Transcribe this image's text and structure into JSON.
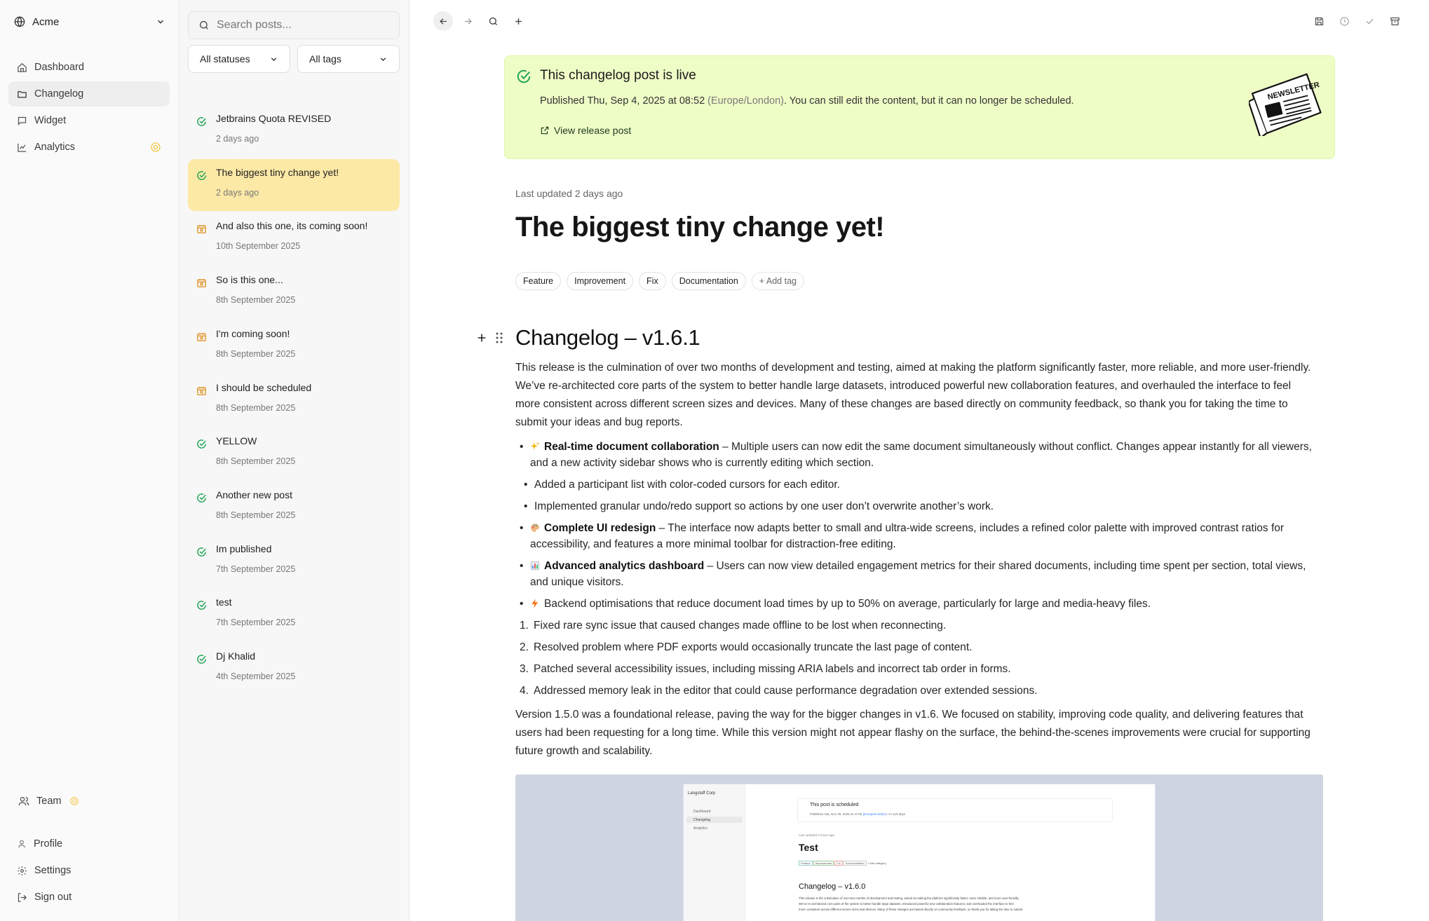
{
  "nav": {
    "workspace": "Acme",
    "items": [
      {
        "label": "Dashboard",
        "icon": "home-icon"
      },
      {
        "label": "Changelog",
        "icon": "folder-icon"
      },
      {
        "label": "Widget",
        "icon": "message-square-icon"
      },
      {
        "label": "Analytics",
        "icon": "chart-line-icon"
      }
    ],
    "bottom": [
      {
        "label": "Team",
        "icon": "users-icon"
      },
      {
        "label": "Profile",
        "icon": "user-icon"
      },
      {
        "label": "Settings",
        "icon": "gear-icon"
      },
      {
        "label": "Sign out",
        "icon": "log-out-icon"
      }
    ]
  },
  "list": {
    "search_placeholder": "Search posts...",
    "status_filter": "All statuses",
    "tag_filter": "All tags",
    "posts": [
      {
        "title": "Jetbrains Quota REVISED",
        "date": "2 days ago",
        "status": "published"
      },
      {
        "title": "The biggest tiny change yet!",
        "date": "2 days ago",
        "status": "published",
        "selected": true
      },
      {
        "title": "And also this one, its coming soon!",
        "date": "10th September 2025",
        "status": "scheduled"
      },
      {
        "title": "So is this one...",
        "date": "8th September 2025",
        "status": "scheduled"
      },
      {
        "title": "I'm coming soon!",
        "date": "8th September 2025",
        "status": "scheduled"
      },
      {
        "title": "I should be scheduled",
        "date": "8th September 2025",
        "status": "scheduled"
      },
      {
        "title": "YELLOW",
        "date": "8th September 2025",
        "status": "published"
      },
      {
        "title": "Another new post",
        "date": "8th September 2025",
        "status": "published"
      },
      {
        "title": "Im published",
        "date": "7th September 2025",
        "status": "published"
      },
      {
        "title": "test",
        "date": "7th September 2025",
        "status": "published"
      },
      {
        "title": "Dj Khalid",
        "date": "4th September 2025",
        "status": "published"
      }
    ]
  },
  "banner": {
    "title": "This changelog post is live",
    "published_prefix": "Published Thu, Sep 4, 2025 at 08:52",
    "timezone": "(Europe/London)",
    "published_suffix": ". You can still edit the content, but it can no longer be scheduled.",
    "link": "View release post",
    "art_text": "NEWSLETTER"
  },
  "post": {
    "updated": "Last updated 2 days ago",
    "title": "The biggest tiny change yet!",
    "tags": [
      "Feature",
      "Improvement",
      "Fix",
      "Documentation"
    ],
    "add_tag": "+ Add tag",
    "heading": "Changelog – v1.6.1",
    "intro": "This release is the culmination of over two months of development and testing, aimed at making the platform significantly faster, more reliable, and more user-friendly. We’ve re-architected core parts of the system to better handle large datasets, introduced powerful new collaboration features, and overhauled the interface to feel more consistent across different screen sizes and devices. Many of these changes are based directly on community feedback, so thank you for taking the time to submit your ideas and bug reports.",
    "b1_bold": "Real-time document collaboration",
    "b1_text": " – Multiple users can now edit the same document simultaneously without conflict. Changes appear instantly for all viewers, and a new activity sidebar shows who is currently editing which section.",
    "b1_sub1": "Added a participant list with color-coded cursors for each editor.",
    "b1_sub2": "Implemented granular undo/redo support so actions by one user don’t overwrite another’s work.",
    "b2_bold": "Complete UI redesign",
    "b2_text": " – The interface now adapts better to small and ultra-wide screens, includes a refined color palette with improved contrast ratios for accessibility, and features a more minimal toolbar for distraction-free editing.",
    "b3_bold": "Advanced analytics dashboard",
    "b3_text": " – Users can now view detailed engagement metrics for their shared documents, including time spent per section, total views, and unique visitors.",
    "b4_text": "Backend optimisations that reduce document load times by up to 50% on average, particularly for large and media-heavy files.",
    "fixes": [
      "Fixed rare sync issue that caused changes made offline to be lost when reconnecting.",
      "Resolved problem where PDF exports would occasionally truncate the last page of content.",
      "Patched several accessibility issues, including missing ARIA labels and incorrect tab order in forms.",
      "Addressed memory leak in the editor that could cause performance degradation over extended sessions."
    ],
    "outro": "Version 1.5.0 was a foundational release, paving the way for the bigger changes in v1.6. We focused on stability, improving code quality, and delivering features that users had been requesting for a long time. While this version might not appear flashy on the surface, the behind-the-scenes improvements were crucial for supporting future growth and scalability."
  },
  "screenshot": {
    "workspace": "Langstaff Corp",
    "nav": [
      "Dashboard",
      "Changelog",
      "Analytics"
    ],
    "notice": "This post is scheduled",
    "notice_prefix": "Publishes Sat, Nov 29, 2025 at 17:00",
    "notice_tz": "(Europe/London)",
    "notice_suffix": " • in 110 days",
    "updated": "Last updated 3 hours ago",
    "title": "Test",
    "tags": [
      "Feature",
      "Improvement",
      "Fix",
      "Documentation"
    ],
    "add_tag": "+ Add category",
    "heading": "Changelog – v1.6.0",
    "line1": "This release is the culmination of over two months of development and testing, aimed at making the platform significantly faster, more reliable, and more user-friendly.",
    "line2": "We’ve re-architected core parts of the system to better handle large datasets, introduced powerful new collaboration features, and overhauled the interface to feel",
    "line3": "more consistent across different screen sizes and devices. Many of these changes are based directly on community feedback, so thank you for taking the time to submit"
  },
  "colors": {
    "published": "#26a65b",
    "scheduled": "#e0962a",
    "selected": "#fde9a6",
    "banner": "#eefcc6",
    "badge": "#f2c94c"
  }
}
